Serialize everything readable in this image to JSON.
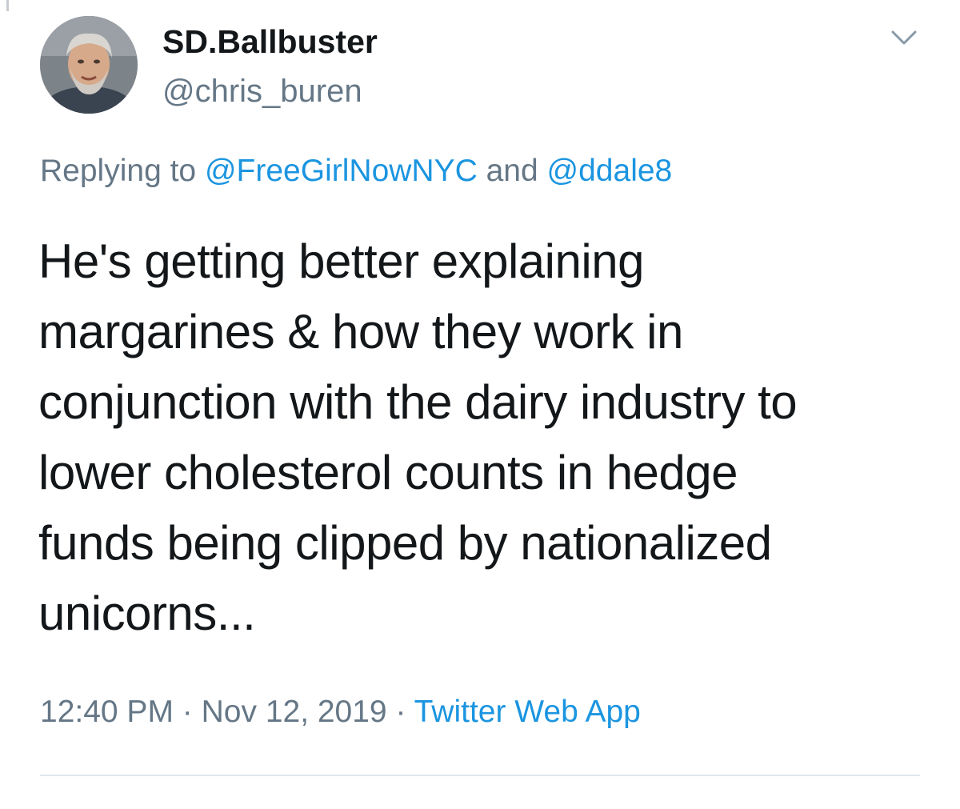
{
  "tweet": {
    "display_name": "SD.Ballbuster",
    "handle": "@chris_buren",
    "replying_prefix": "Replying to",
    "reply_to_1": "@FreeGirlNowNYC",
    "reply_joiner": "and",
    "reply_to_2": "@ddale8",
    "text": "He's getting better explaining\nmargarines & how they work in\nconjunction with the dairy industry to\nlower cholesterol counts in hedge\nfunds being clipped by nationalized\nunicorns...",
    "time": "12:40 PM",
    "separator": "·",
    "date": "Nov 12, 2019",
    "source": "Twitter Web App"
  },
  "icons": {
    "menu": "chevron-down-icon",
    "avatar": "avatar"
  },
  "colors": {
    "text": "#14171a",
    "secondary": "#657786",
    "link": "#1b95e0",
    "divider": "#e1e8ed"
  }
}
